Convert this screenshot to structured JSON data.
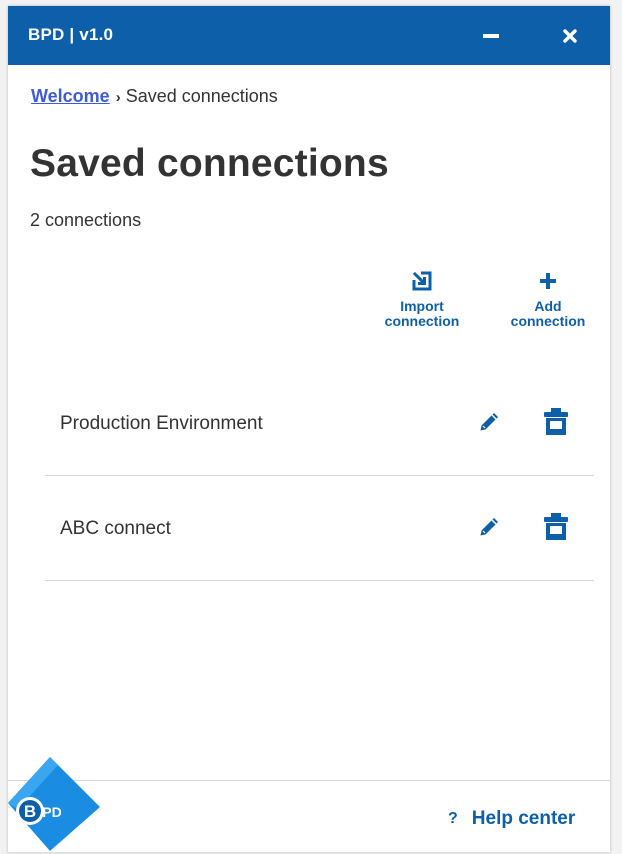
{
  "window": {
    "title": "BPD | v1.0",
    "minimize_icon": "minus-icon",
    "close_icon": "close-icon"
  },
  "breadcrumb": {
    "home": "Welcome",
    "separator": "›",
    "current": "Saved connections"
  },
  "page": {
    "title": "Saved connections",
    "count": "2 connections"
  },
  "actions": {
    "import": {
      "label": "Import connection",
      "icon": "import-icon"
    },
    "add": {
      "label": "Add connection",
      "icon": "plus-icon"
    }
  },
  "connections": [
    {
      "name": "Production Environment",
      "edit_icon": "pencil-icon",
      "delete_icon": "trash-icon"
    },
    {
      "name": "ABC connect",
      "edit_icon": "pencil-icon",
      "delete_icon": "trash-icon"
    }
  ],
  "footer": {
    "logo_text": "BPD",
    "help_icon": "?",
    "help_label": "Help center"
  },
  "colors": {
    "brand": "#0e5fa9",
    "link": "#3d5bd8",
    "text": "#333333",
    "divider": "#d5d5d5"
  }
}
